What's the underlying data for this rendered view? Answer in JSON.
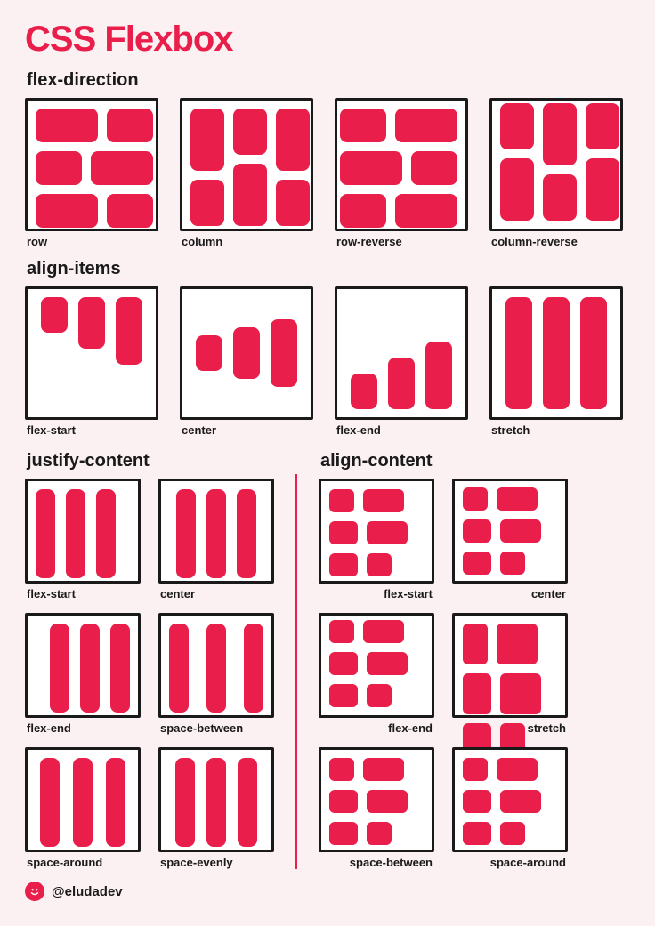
{
  "title": "CSS Flexbox",
  "sections": {
    "flex_direction": {
      "heading": "flex-direction",
      "items": [
        "row",
        "column",
        "row-reverse",
        "column-reverse"
      ]
    },
    "align_items": {
      "heading": "align-items",
      "items": [
        "flex-start",
        "center",
        "flex-end",
        "stretch"
      ]
    },
    "justify_content": {
      "heading": "justify-content",
      "items": [
        "flex-start",
        "center",
        "flex-end",
        "space-between",
        "space-around",
        "space-evenly"
      ]
    },
    "align_content": {
      "heading": "align-content",
      "items": [
        "flex-start",
        "center",
        "flex-end",
        "stretch",
        "space-between",
        "space-around"
      ]
    }
  },
  "footer": {
    "handle": "@eludadev"
  }
}
